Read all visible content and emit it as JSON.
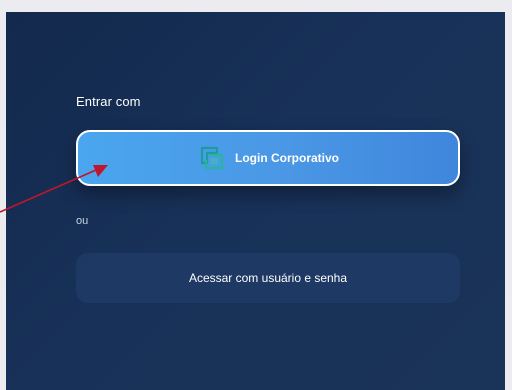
{
  "form": {
    "heading": "Entrar com",
    "primary_button_label": "Login Corporativo",
    "primary_button_icon": "corporate-login-icon",
    "separator": "ou",
    "secondary_button_label": "Acessar com usuário e senha"
  },
  "annotation": {
    "arrow_color": "#c0162b"
  },
  "colors": {
    "background": "#183158",
    "primary_button": "#4a97e5",
    "secondary_button": "#203c68"
  }
}
